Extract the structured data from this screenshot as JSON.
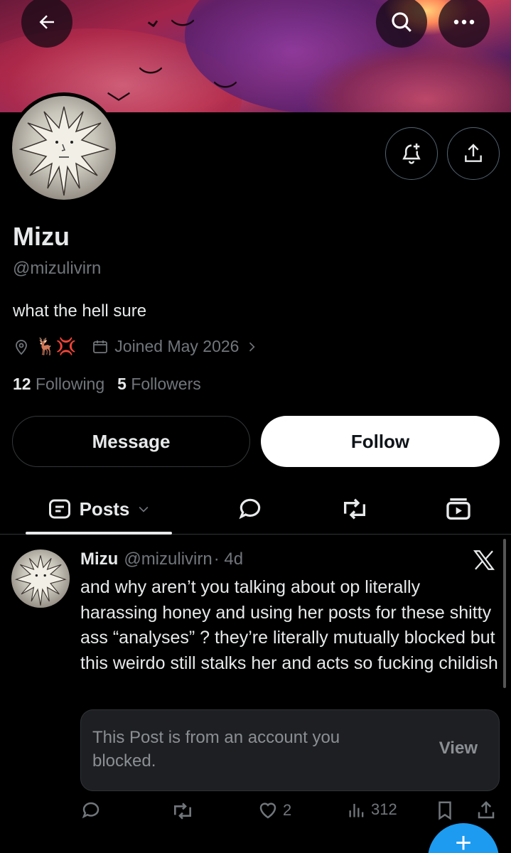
{
  "profile": {
    "name": "Mizu",
    "handle": "@mizulivirn",
    "bio": "what the hell sure",
    "location_emoji": "🦌💢",
    "joined": "Joined May 2026",
    "following_count": "12",
    "following_label": "Following",
    "followers_count": "5",
    "followers_label": "Followers"
  },
  "buttons": {
    "message": "Message",
    "follow": "Follow"
  },
  "tabs": {
    "posts": "Posts"
  },
  "post": {
    "name": "Mizu",
    "handle": "@mizulivirn",
    "time": "· 4d",
    "text": "and why aren’t you talking about op literally harassing honey and using her posts for these shitty ass “analyses” ? they’re literally mutually blocked but this weirdo still stalks her and acts so fucking childish",
    "quoted_blocked_text": "This Post is from an account you blocked.",
    "quoted_view": "View",
    "likes": "2",
    "views": "312"
  },
  "colors": {
    "background": "#000000",
    "primary_text": "#e7e9ea",
    "secondary_text": "#71767b",
    "accent": "#1d9bf0"
  },
  "icons": [
    "back-arrow-icon",
    "search-icon",
    "more-icon",
    "notification-add-icon",
    "share-icon",
    "location-icon",
    "calendar-icon",
    "chevron-right-icon",
    "posts-icon",
    "chevron-down-icon",
    "replies-icon",
    "repost-icon",
    "media-icon",
    "x-logo-icon",
    "reply-icon",
    "like-icon",
    "views-icon",
    "bookmark-icon",
    "compose-icon"
  ]
}
